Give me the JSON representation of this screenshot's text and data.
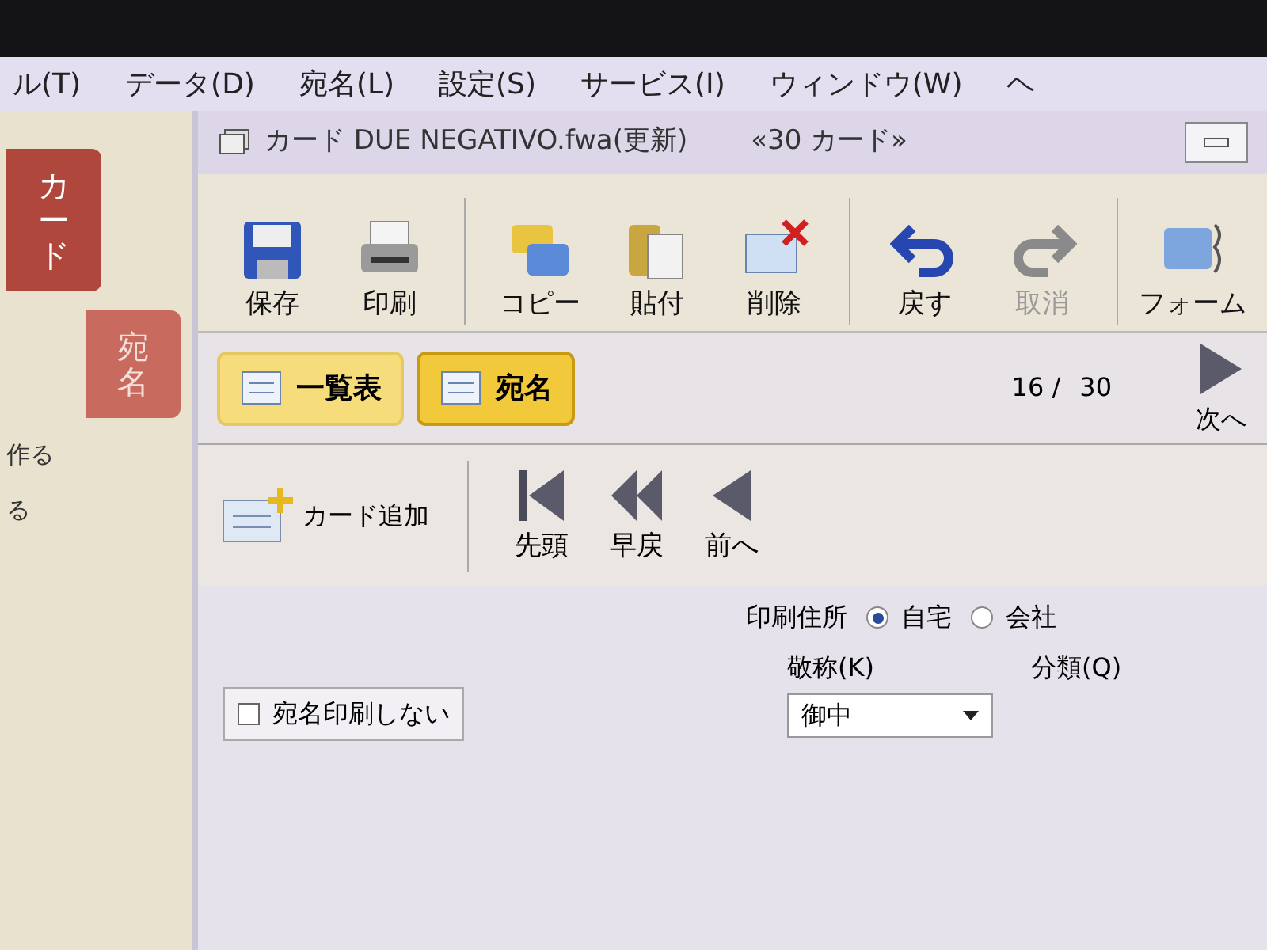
{
  "menu": [
    "ル(T)",
    "データ(D)",
    "宛名(L)",
    "設定(S)",
    "サービス(I)",
    "ウィンドウ(W)",
    "ヘ"
  ],
  "window": {
    "title": "カード DUE NEGATIVO.fwa(更新)",
    "count": "«30 カード»"
  },
  "sidebar": {
    "tabs": [
      {
        "label": "カード",
        "selected": true
      },
      {
        "label": "宛名",
        "selected": false
      }
    ],
    "texts": [
      "作る",
      "る"
    ]
  },
  "toolbar": [
    {
      "label": "保存",
      "disabled": false
    },
    {
      "label": "印刷",
      "disabled": false
    },
    {
      "label": "コピー",
      "disabled": false
    },
    {
      "label": "貼付",
      "disabled": false
    },
    {
      "label": "削除",
      "disabled": false
    },
    {
      "label": "戻す",
      "disabled": false
    },
    {
      "label": "取消",
      "disabled": true
    },
    {
      "label": "フォーム",
      "disabled": false
    }
  ],
  "views": [
    {
      "label": "一覧表",
      "selected": false
    },
    {
      "label": "宛名",
      "selected": true
    }
  ],
  "add_card": "カード追加",
  "nav": [
    {
      "label": "先頭"
    },
    {
      "label": "早戻"
    },
    {
      "label": "前へ"
    }
  ],
  "position": {
    "current": "16 /",
    "total": "30"
  },
  "next": "次へ",
  "form": {
    "address_label": "印刷住所",
    "address_options": [
      {
        "label": "自宅",
        "selected": true
      },
      {
        "label": "会社",
        "selected": false
      }
    ],
    "category_label": "分類(Q)",
    "title_label": "敬称(K)",
    "title_value": "御中",
    "no_print": {
      "label": "宛名印刷しない",
      "checked": false
    }
  }
}
